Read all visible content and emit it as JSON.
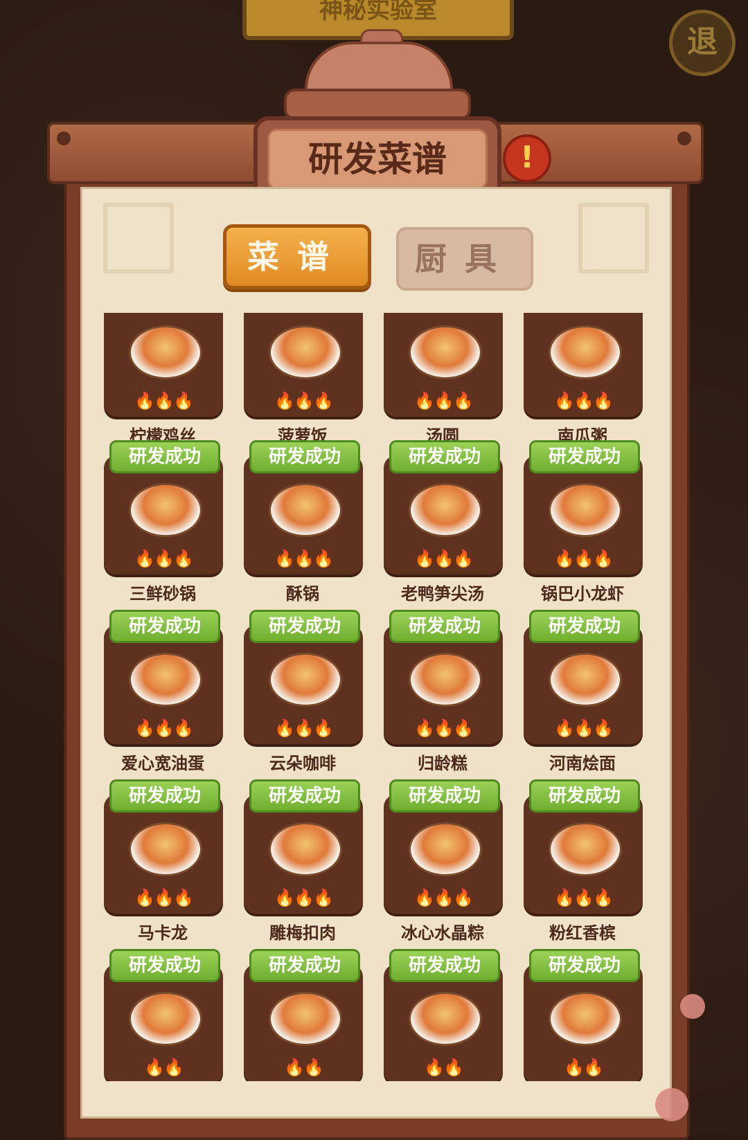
{
  "header": {
    "top_sign_label": "神秘实验室",
    "exit_label": "退",
    "title": "研发菜谱",
    "alert_label": "!"
  },
  "tabs": [
    {
      "label": "菜谱",
      "active": true
    },
    {
      "label": "厨具",
      "active": false
    }
  ],
  "success_badge": "研发成功",
  "flame_glyph": "🔥",
  "recipes": [
    {
      "name": "柠檬鸡丝",
      "badge": false,
      "flames": 3
    },
    {
      "name": "菠萝饭",
      "badge": false,
      "flames": 3
    },
    {
      "name": "汤圆",
      "badge": false,
      "flames": 3
    },
    {
      "name": "南瓜粥",
      "badge": false,
      "flames": 3
    },
    {
      "name": "三鲜砂锅",
      "badge": true,
      "flames": 3
    },
    {
      "name": "酥锅",
      "badge": true,
      "flames": 3
    },
    {
      "name": "老鸭笋尖汤",
      "badge": true,
      "flames": 3
    },
    {
      "name": "锅巴小龙虾",
      "badge": true,
      "flames": 3
    },
    {
      "name": "爱心宽油蛋",
      "badge": true,
      "flames": 3
    },
    {
      "name": "云朵咖啡",
      "badge": true,
      "flames": 3
    },
    {
      "name": "归龄糕",
      "badge": true,
      "flames": 3
    },
    {
      "name": "河南烩面",
      "badge": true,
      "flames": 3
    },
    {
      "name": "马卡龙",
      "badge": true,
      "flames": 3
    },
    {
      "name": "雕梅扣肉",
      "badge": true,
      "flames": 3
    },
    {
      "name": "冰心水晶粽",
      "badge": true,
      "flames": 3
    },
    {
      "name": "粉红香槟",
      "badge": true,
      "flames": 3
    },
    {
      "name": "",
      "badge": true,
      "flames": 2
    },
    {
      "name": "",
      "badge": true,
      "flames": 2
    },
    {
      "name": "",
      "badge": true,
      "flames": 2
    },
    {
      "name": "",
      "badge": true,
      "flames": 2
    }
  ],
  "colors": {
    "panel": "#efe2c8",
    "tile": "#5e321f",
    "badge_green": "#7bbd36",
    "tab_active": "#e9992f"
  }
}
